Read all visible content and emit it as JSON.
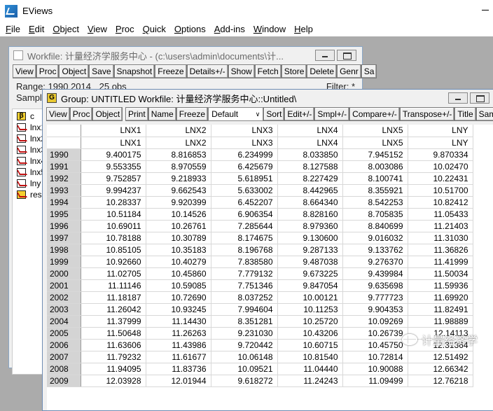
{
  "app": {
    "title": "EViews",
    "menu": [
      "File",
      "Edit",
      "Object",
      "View",
      "Proc",
      "Quick",
      "Options",
      "Add-ins",
      "Window",
      "Help"
    ]
  },
  "workfile_window": {
    "title": "Workfile: 计量经济学服务中心 - (c:\\users\\admin\\documents\\计...",
    "toolbar": [
      "View",
      "Proc",
      "Object",
      "Save",
      "Snapshot",
      "Freeze",
      "Details+/-",
      "Show",
      "Fetch",
      "Store",
      "Delete",
      "Genr",
      "Sa"
    ],
    "range_label": "Range:",
    "range_value": "1990 2014",
    "range_obs": "25 obs",
    "sample_label": "Sample:",
    "filter_label": "Filter: *",
    "items": [
      {
        "icon": "beta",
        "name": "c"
      },
      {
        "icon": "series",
        "name": "lnx1"
      },
      {
        "icon": "series",
        "name": "lnx2"
      },
      {
        "icon": "series",
        "name": "lnx3"
      },
      {
        "icon": "series",
        "name": "lnx4"
      },
      {
        "icon": "series",
        "name": "lnx5"
      },
      {
        "icon": "series",
        "name": "lny"
      },
      {
        "icon": "resid",
        "name": "resid"
      }
    ]
  },
  "group_window": {
    "title": "Group: UNTITLED    Workfile: 计量经济学服务中心::Untitled\\",
    "icon_letter": "G",
    "toolbar": [
      "View",
      "Proc",
      "Object",
      "Print",
      "Name",
      "Freeze",
      "Sort",
      "Edit+/-",
      "Smpl+/-",
      "Compare+/-",
      "Transpose+/-",
      "Title",
      "Samp"
    ],
    "format_select": "Default",
    "columns": [
      "LNX1",
      "LNX2",
      "LNX3",
      "LNX4",
      "LNX5",
      "LNY"
    ],
    "rows": [
      {
        "obs": "1990",
        "values": [
          "9.400175",
          "8.816853",
          "6.234999",
          "8.033850",
          "7.945152",
          "9.870334"
        ]
      },
      {
        "obs": "1991",
        "values": [
          "9.553355",
          "8.970559",
          "6.425679",
          "8.127588",
          "8.003086",
          "10.02470"
        ]
      },
      {
        "obs": "1992",
        "values": [
          "9.752857",
          "9.218933",
          "5.618951",
          "8.227429",
          "8.100741",
          "10.22431"
        ]
      },
      {
        "obs": "1993",
        "values": [
          "9.994237",
          "9.662543",
          "5.633002",
          "8.442965",
          "8.355921",
          "10.51700"
        ]
      },
      {
        "obs": "1994",
        "values": [
          "10.28337",
          "9.920399",
          "6.452207",
          "8.664340",
          "8.542253",
          "10.82412"
        ]
      },
      {
        "obs": "1995",
        "values": [
          "10.51184",
          "10.14526",
          "6.906354",
          "8.828160",
          "8.705835",
          "11.05433"
        ]
      },
      {
        "obs": "1996",
        "values": [
          "10.69011",
          "10.26761",
          "7.285644",
          "8.979360",
          "8.840699",
          "11.21403"
        ]
      },
      {
        "obs": "1997",
        "values": [
          "10.78188",
          "10.30789",
          "8.174675",
          "9.130600",
          "9.016032",
          "11.31030"
        ]
      },
      {
        "obs": "1998",
        "values": [
          "10.85105",
          "10.35183",
          "8.196768",
          "9.287133",
          "9.133762",
          "11.36826"
        ]
      },
      {
        "obs": "1999",
        "values": [
          "10.92660",
          "10.40279",
          "7.838580",
          "9.487038",
          "9.276370",
          "11.41999"
        ]
      },
      {
        "obs": "2000",
        "values": [
          "11.02705",
          "10.45860",
          "7.779132",
          "9.673225",
          "9.439984",
          "11.50034"
        ]
      },
      {
        "obs": "2001",
        "values": [
          "11.11146",
          "10.59085",
          "7.751346",
          "9.847054",
          "9.635698",
          "11.59936"
        ]
      },
      {
        "obs": "2002",
        "values": [
          "11.18187",
          "10.72690",
          "8.037252",
          "10.00121",
          "9.777723",
          "11.69920"
        ]
      },
      {
        "obs": "2003",
        "values": [
          "11.26042",
          "10.93245",
          "7.994604",
          "10.11253",
          "9.904353",
          "11.82491"
        ]
      },
      {
        "obs": "2004",
        "values": [
          "11.37999",
          "11.14430",
          "8.351281",
          "10.25720",
          "10.09269",
          "11.98889"
        ]
      },
      {
        "obs": "2005",
        "values": [
          "11.50648",
          "11.26263",
          "9.231030",
          "10.43206",
          "10.26739",
          "12.14113"
        ]
      },
      {
        "obs": "2006",
        "values": [
          "11.63606",
          "11.43986",
          "9.720442",
          "10.60715",
          "10.45750",
          "12.31364"
        ]
      },
      {
        "obs": "2007",
        "values": [
          "11.79232",
          "11.61677",
          "10.06148",
          "10.81540",
          "10.72814",
          "12.51492"
        ]
      },
      {
        "obs": "2008",
        "values": [
          "11.94095",
          "11.83736",
          "10.09521",
          "11.04440",
          "10.90088",
          "12.66342"
        ]
      },
      {
        "obs": "2009",
        "values": [
          "12.03928",
          "12.01944",
          "9.618272",
          "11.24243",
          "11.09499",
          "12.76218"
        ]
      }
    ]
  },
  "watermark": "计量经济学"
}
